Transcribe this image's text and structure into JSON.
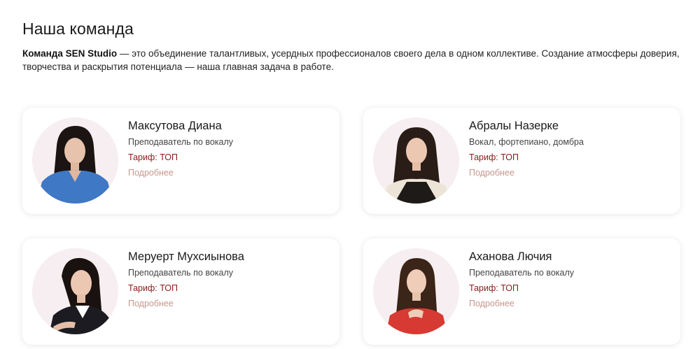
{
  "section": {
    "title": "Наша команда",
    "intro_bold": "Команда SEN Studio",
    "intro_text": " — это объединение талантливых, усердных профессионалов своего дела в одном коллективе. Создание атмосферы доверия, творчества и раскрытия потенциала — наша главная задача в работе."
  },
  "team": [
    {
      "name": "Максутова Диана",
      "role": "Преподаватель по вокалу",
      "tariff": "Тариф: ТОП",
      "more": "Подробнее"
    },
    {
      "name": "Абралы Назерке",
      "role": "Вокал, фортепиано, домбра",
      "tariff": "Тариф: ТОП",
      "more": "Подробнее"
    },
    {
      "name": "Меруерт Мухсиынова",
      "role": "Преподаватель по вокалу",
      "tariff": "Тариф: ТОП",
      "more": "Подробнее"
    },
    {
      "name": "Аханова Лючия",
      "role": "Преподаватель по вокалу",
      "tariff": "Тариф: ТОП",
      "more": "Подробнее"
    }
  ],
  "colors": {
    "tariff": "#8b1a1a",
    "more_link": "#c8968c",
    "avatar_bg": "#f6eef0"
  }
}
